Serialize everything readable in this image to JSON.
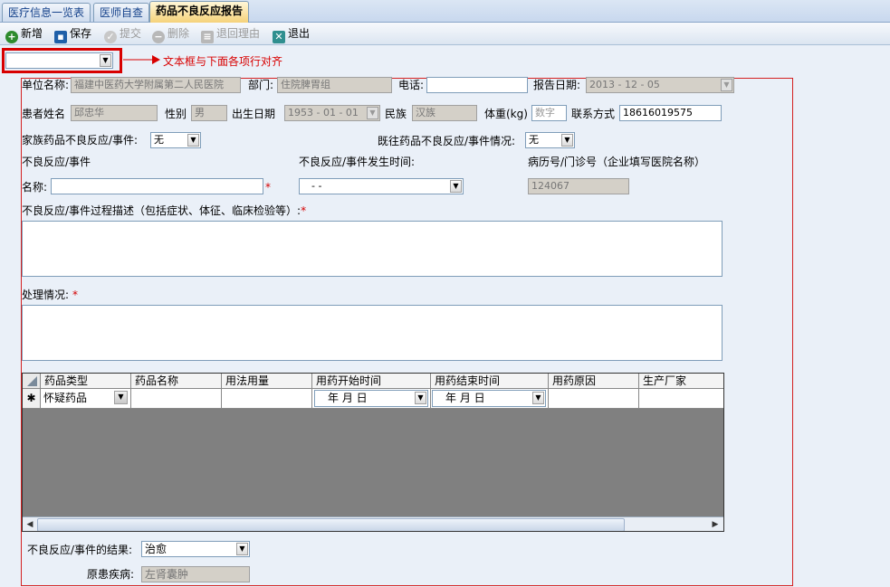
{
  "tabs": [
    {
      "label": "医疗信息一览表"
    },
    {
      "label": "医师自查"
    },
    {
      "label": "药品不良反应报告"
    }
  ],
  "toolbar": {
    "new_label": "新增",
    "save_label": "保存",
    "submit_label": "提交",
    "delete_label": "删除",
    "return_reason_label": "退回理由",
    "exit_label": "退出"
  },
  "annotation": {
    "text": "文本框与下面各项行对齐"
  },
  "form": {
    "unit_label": "单位名称:",
    "unit_value": "福建中医药大学附属第二人民医院",
    "dept_label": "部门:",
    "dept_value": "住院脾胃组",
    "phone_label": "电话:",
    "phone_value": "",
    "report_date_label": "报告日期:",
    "report_date_value": "2013 - 12 - 05",
    "patient_label": "患者姓名",
    "patient_value": "邱忠华",
    "sex_label": "性别",
    "sex_value": "男",
    "birth_label": "出生日期",
    "birth_value": "1953 - 01 - 01",
    "ethnic_label": "民族",
    "ethnic_value": "汉族",
    "weight_label": "体重(kg)",
    "weight_placeholder": "数字",
    "contact_label": "联系方式",
    "contact_value": "18616019575",
    "family_adr_label": "家族药品不良反应/事件:",
    "family_adr_value": "无",
    "past_adr_label": "既往药品不良反应/事件情况:",
    "past_adr_value": "无",
    "adr_label": "不良反应/事件",
    "adr_time_label": "不良反应/事件发生时间:",
    "record_no_label": "病历号/门诊号（企业填写医院名称）",
    "name_label": "名称:",
    "name_value": "",
    "adr_time_value": "-   -",
    "record_no_value": "124067",
    "process_label": "不良反应/事件过程描述（包括症状、体征、临床检验等）:",
    "handling_label": "处理情况:",
    "required_mark": "*",
    "result_label": "不良反应/事件的结果:",
    "result_value": "治愈",
    "original_disease_label": "原患疾病:",
    "original_disease_value": "左肾囊肿"
  },
  "grid": {
    "columns": [
      "药品类型",
      "药品名称",
      "用法用量",
      "用药开始时间",
      "用药结束时间",
      "用药原因",
      "生产厂家"
    ],
    "new_row_marker": "✱",
    "row": {
      "drug_type": "怀疑药品",
      "start_date": "年    月    日",
      "end_date": "年    月    日"
    }
  }
}
